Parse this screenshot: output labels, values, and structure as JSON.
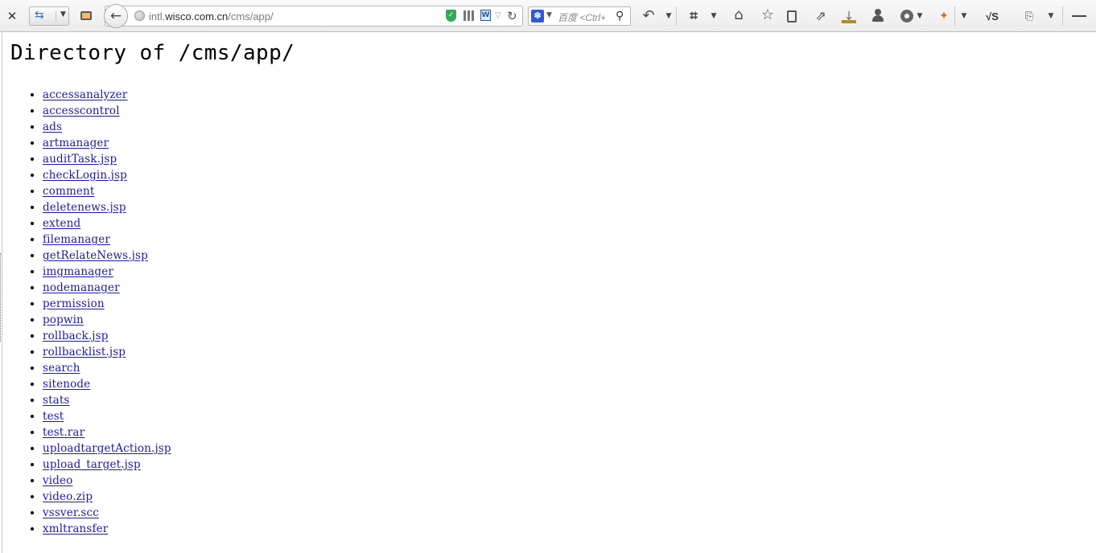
{
  "browser": {
    "url_prefix": "intl.",
    "url_host": "wisco.com.cn",
    "url_path": "/cms/app/",
    "search_placeholder": "百度 <Ctrl+",
    "word_badge": "W",
    "vs_label": "√S",
    "icons": {
      "close": "close-icon",
      "back": "back-arrow-icon",
      "reload": "reload-icon",
      "search": "magnifier-icon",
      "menu": "hamburger-menu-icon"
    }
  },
  "page": {
    "title": "Directory of /cms/app/",
    "link_color": "#1a1aa6",
    "entries": [
      "accessanalyzer",
      "accesscontrol",
      "ads",
      "artmanager",
      "auditTask.jsp",
      "checkLogin.jsp",
      "comment",
      "deletenews.jsp",
      "extend",
      "filemanager",
      "getRelateNews.jsp",
      "imgmanager",
      "nodemanager",
      "permission",
      "popwin",
      "rollback.jsp",
      "rollbacklist.jsp",
      "search",
      "sitenode",
      "stats",
      "test",
      "test.rar",
      "uploadtargetAction.jsp",
      "upload_target.jsp",
      "video",
      "video.zip",
      "vssver.scc",
      "xmltransfer"
    ]
  }
}
